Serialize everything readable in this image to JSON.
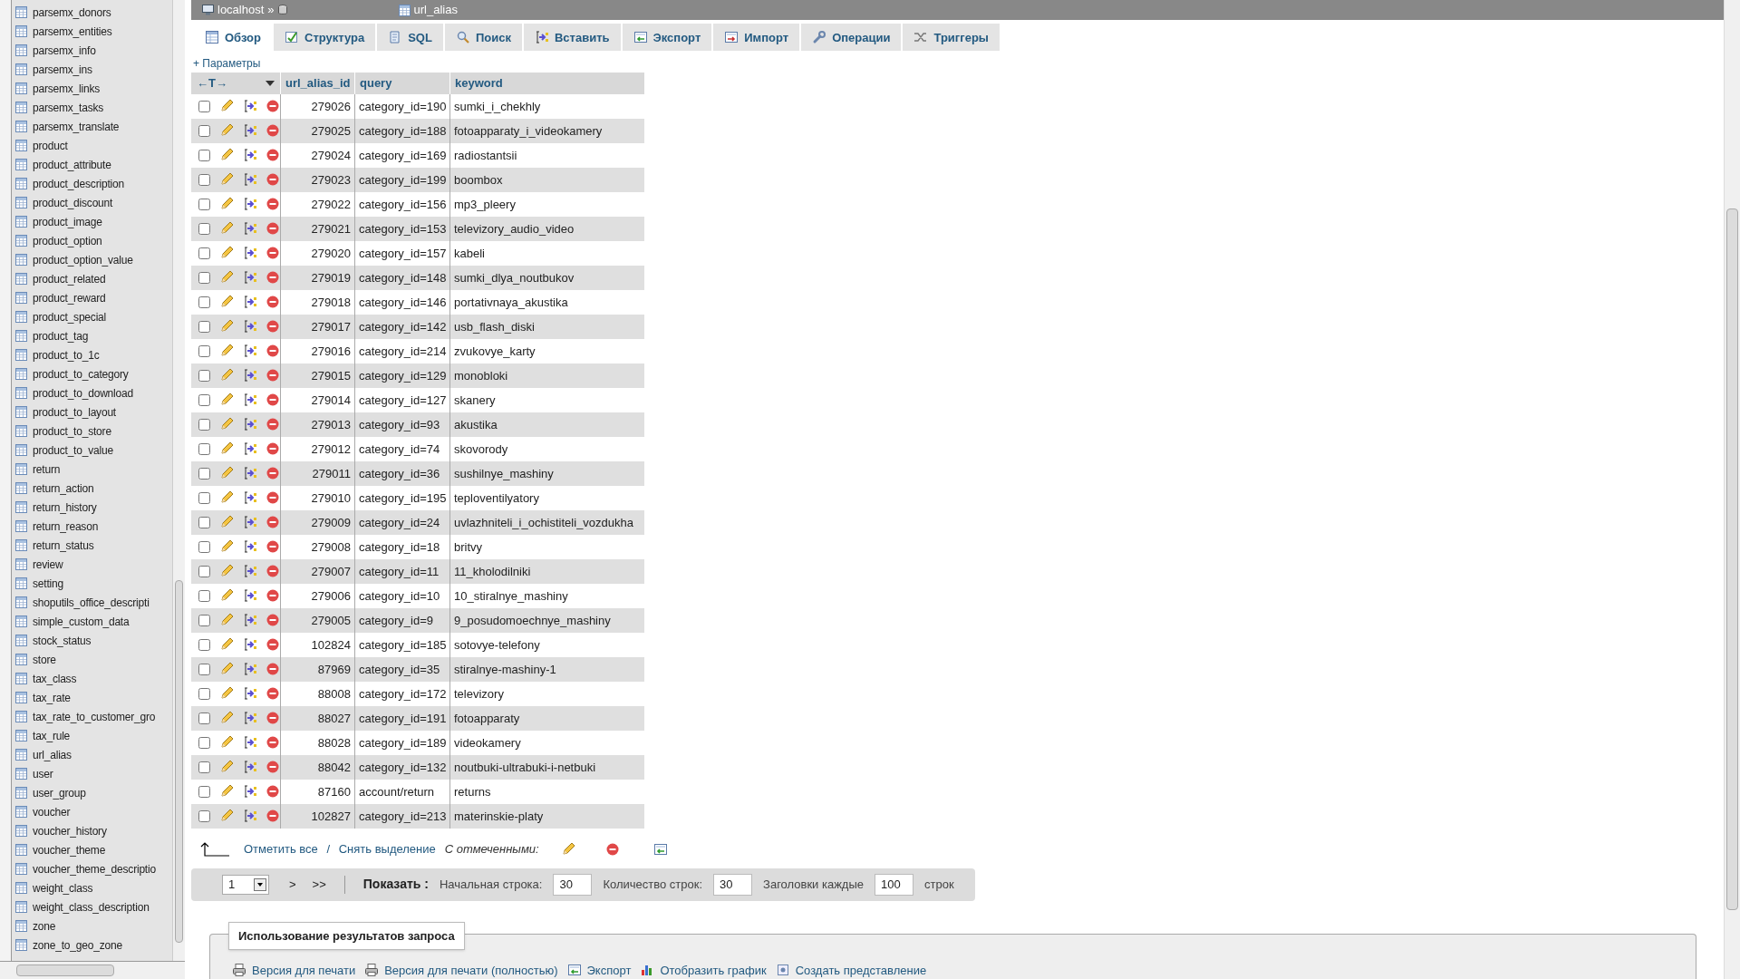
{
  "sidebar": {
    "items": [
      "parsemx_donors",
      "parsemx_entities",
      "parsemx_info",
      "parsemx_ins",
      "parsemx_links",
      "parsemx_tasks",
      "parsemx_translate",
      "product",
      "product_attribute",
      "product_description",
      "product_discount",
      "product_image",
      "product_option",
      "product_option_value",
      "product_related",
      "product_reward",
      "product_special",
      "product_tag",
      "product_to_1c",
      "product_to_category",
      "product_to_download",
      "product_to_layout",
      "product_to_store",
      "product_to_value",
      "return",
      "return_action",
      "return_history",
      "return_reason",
      "return_status",
      "review",
      "setting",
      "shoputils_office_descripti",
      "simple_custom_data",
      "stock_status",
      "store",
      "tax_class",
      "tax_rate",
      "tax_rate_to_customer_gro",
      "tax_rule",
      "url_alias",
      "user",
      "user_group",
      "voucher",
      "voucher_history",
      "voucher_theme",
      "voucher_theme_descriptio",
      "weight_class",
      "weight_class_description",
      "zone",
      "zone_to_geo_zone"
    ]
  },
  "breadcrumb": {
    "server": "localhost",
    "separator": "»",
    "table": "url_alias"
  },
  "tabs": [
    {
      "label": "Обзор",
      "kind": "browse",
      "selected": true
    },
    {
      "label": "Структура",
      "kind": "structure",
      "selected": false
    },
    {
      "label": "SQL",
      "kind": "sql",
      "selected": false
    },
    {
      "label": "Поиск",
      "kind": "search",
      "selected": false
    },
    {
      "label": "Вставить",
      "kind": "insert",
      "selected": false
    },
    {
      "label": "Экспорт",
      "kind": "export",
      "selected": false
    },
    {
      "label": "Импорт",
      "kind": "import",
      "selected": false
    },
    {
      "label": "Операции",
      "kind": "operations",
      "selected": false
    },
    {
      "label": "Триггеры",
      "kind": "triggers",
      "selected": false
    }
  ],
  "options_link": "+ Параметры",
  "table": {
    "resize_handle": "←T→",
    "columns": [
      "url_alias_id",
      "query",
      "keyword"
    ],
    "rows": [
      {
        "cells": [
          "279026",
          "category_id=190",
          "sumki_i_chekhly"
        ],
        "checked": false
      },
      {
        "cells": [
          "279025",
          "category_id=188",
          "fotoapparaty_i_videokamery"
        ],
        "checked": false
      },
      {
        "cells": [
          "279024",
          "category_id=169",
          "radiostantsii"
        ],
        "checked": false
      },
      {
        "cells": [
          "279023",
          "category_id=199",
          "boombox"
        ],
        "checked": false
      },
      {
        "cells": [
          "279022",
          "category_id=156",
          "mp3_pleery"
        ],
        "checked": false
      },
      {
        "cells": [
          "279021",
          "category_id=153",
          "televizory_audio_video"
        ],
        "checked": false
      },
      {
        "cells": [
          "279020",
          "category_id=157",
          "kabeli"
        ],
        "checked": false
      },
      {
        "cells": [
          "279019",
          "category_id=148",
          "sumki_dlya_noutbukov"
        ],
        "checked": false
      },
      {
        "cells": [
          "279018",
          "category_id=146",
          "portativnaya_akustika"
        ],
        "checked": false
      },
      {
        "cells": [
          "279017",
          "category_id=142",
          "usb_flash_diski"
        ],
        "checked": false
      },
      {
        "cells": [
          "279016",
          "category_id=214",
          "zvukovye_karty"
        ],
        "checked": false
      },
      {
        "cells": [
          "279015",
          "category_id=129",
          "monobloki"
        ],
        "checked": false
      },
      {
        "cells": [
          "279014",
          "category_id=127",
          "skanery"
        ],
        "checked": false
      },
      {
        "cells": [
          "279013",
          "category_id=93",
          "akustika"
        ],
        "checked": false
      },
      {
        "cells": [
          "279012",
          "category_id=74",
          "skovorody"
        ],
        "checked": false
      },
      {
        "cells": [
          "279011",
          "category_id=36",
          "sushilnye_mashiny"
        ],
        "checked": false
      },
      {
        "cells": [
          "279010",
          "category_id=195",
          "teploventilyatory"
        ],
        "checked": false
      },
      {
        "cells": [
          "279009",
          "category_id=24",
          "uvlazhniteli_i_ochistiteli_vozdukha"
        ],
        "checked": false
      },
      {
        "cells": [
          "279008",
          "category_id=18",
          "britvy"
        ],
        "checked": false
      },
      {
        "cells": [
          "279007",
          "category_id=11",
          "11_kholodilniki"
        ],
        "checked": false
      },
      {
        "cells": [
          "279006",
          "category_id=10",
          "10_stiralnye_mashiny"
        ],
        "checked": false
      },
      {
        "cells": [
          "279005",
          "category_id=9",
          "9_posudomoechnye_mashiny"
        ],
        "checked": false
      },
      {
        "cells": [
          "102824",
          "category_id=185",
          "sotovye-telefony"
        ],
        "checked": false
      },
      {
        "cells": [
          "87969",
          "category_id=35",
          "stiralnye-mashiny-1"
        ],
        "checked": false
      },
      {
        "cells": [
          "88008",
          "category_id=172",
          "televizory"
        ],
        "checked": false
      },
      {
        "cells": [
          "88027",
          "category_id=191",
          "fotoapparaty"
        ],
        "checked": false
      },
      {
        "cells": [
          "88028",
          "category_id=189",
          "videokamery"
        ],
        "checked": false
      },
      {
        "cells": [
          "88042",
          "category_id=132",
          "noutbuki-ultrabuki-i-netbuki"
        ],
        "checked": false
      },
      {
        "cells": [
          "87160",
          "account/return",
          "returns"
        ],
        "checked": false
      },
      {
        "cells": [
          "102827",
          "category_id=213",
          "materinskie-platy"
        ],
        "checked": false
      }
    ]
  },
  "bulk": {
    "check_all": "Отметить все",
    "separator": " / ",
    "uncheck_all": "Снять выделение",
    "with_selected": "С отмеченными:"
  },
  "pager": {
    "page": "1",
    "next": ">",
    "last": ">>",
    "show": "Показать :",
    "start_label": "Начальная строка:",
    "start": "30",
    "count_label": "Количество строк:",
    "count": "30",
    "headers_label": "Заголовки каждые",
    "headers": "100",
    "rows_label": "строк"
  },
  "query_results": {
    "legend": "Использование результатов запроса",
    "links": [
      {
        "label": "Версия для печати",
        "kind": "print"
      },
      {
        "label": "Версия для печати (полностью)",
        "kind": "print"
      },
      {
        "label": "Экспорт",
        "kind": "export"
      },
      {
        "label": "Отобразить график",
        "kind": "chart"
      },
      {
        "label": "Создать представление",
        "kind": "view"
      }
    ]
  }
}
